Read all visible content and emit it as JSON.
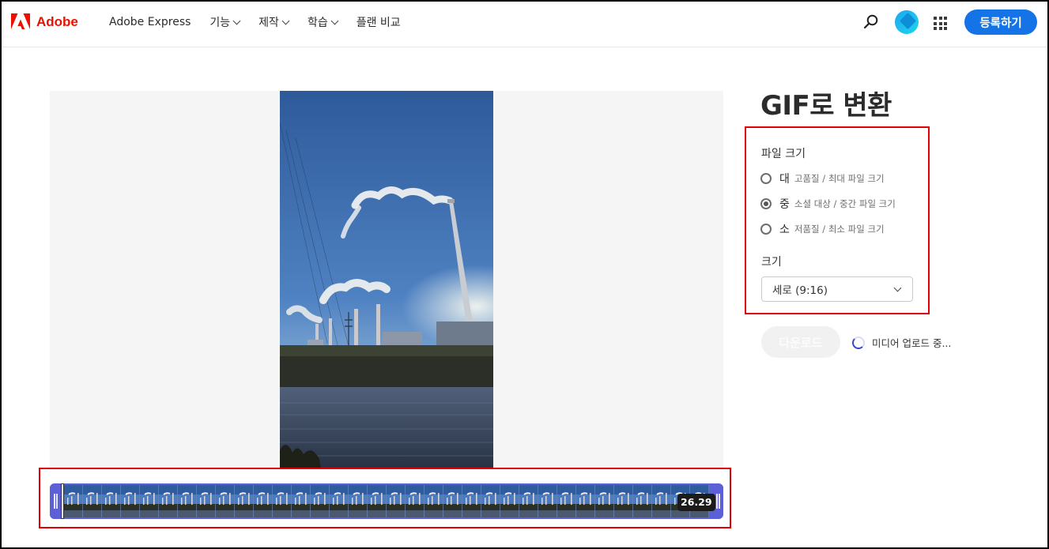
{
  "header": {
    "logo_text": "Adobe",
    "nav": [
      {
        "label": "Adobe Express",
        "has_dropdown": false
      },
      {
        "label": "기능",
        "has_dropdown": true
      },
      {
        "label": "제작",
        "has_dropdown": true
      },
      {
        "label": "학습",
        "has_dropdown": true
      },
      {
        "label": "플랜 비교",
        "has_dropdown": false
      }
    ],
    "signup_label": "등록하기",
    "icons": [
      "adobe-logo-icon",
      "search-icon",
      "avatar",
      "app-grid-icon"
    ],
    "brand_color": "#eb1000",
    "accent_color": "#1473e6"
  },
  "timeline": {
    "duration": "26.29",
    "track_color": "#5d5fd6"
  },
  "panel": {
    "title": "GIF로 변환",
    "file_size_label": "파일 크기",
    "options": [
      {
        "main": "대",
        "sub": "고품질 / 최대 파일 크기",
        "checked": false
      },
      {
        "main": "중",
        "sub": "소셜 대상 / 중간 파일 크기",
        "checked": true
      },
      {
        "main": "소",
        "sub": "저품질 / 최소 파일 크기",
        "checked": false
      }
    ],
    "size_label": "크기",
    "size_value": "세로 (9:16)",
    "download_label": "다운로드",
    "status_text": "미디어 업로드 중...",
    "highlight_color": "#e0000a"
  }
}
